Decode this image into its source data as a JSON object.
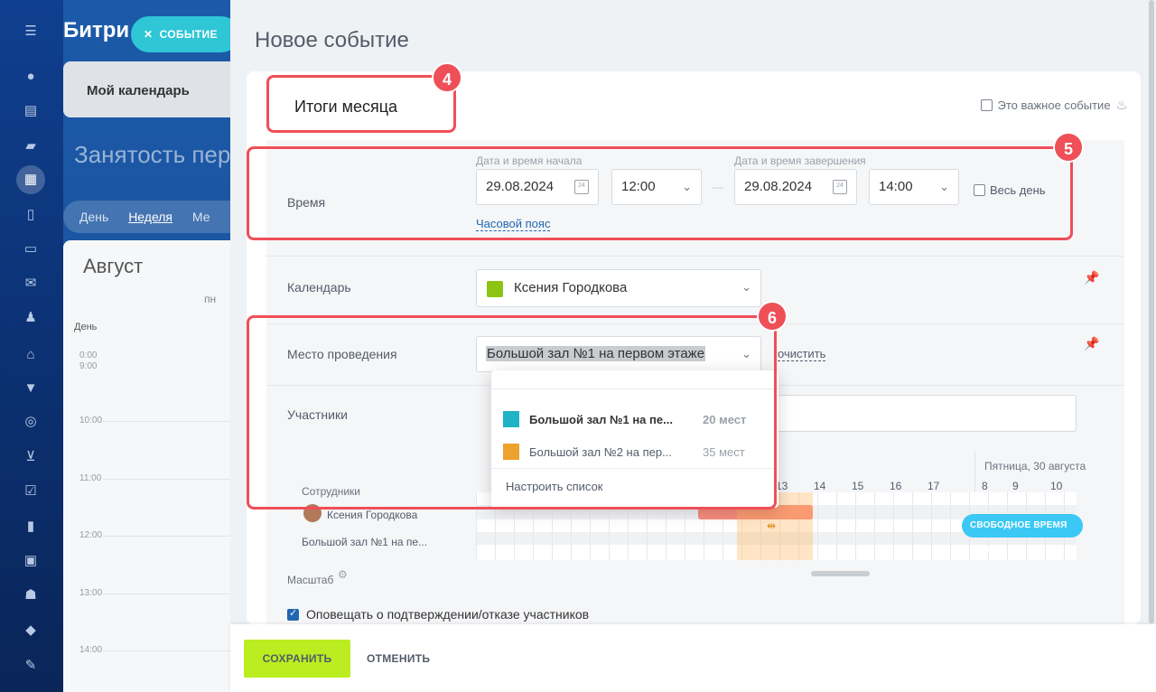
{
  "background": {
    "brand": "Битри",
    "event_button": "СОБЫТИЕ",
    "my_calendar": "Мой календарь",
    "busy_title": "Занятость пер",
    "views": [
      "День",
      "Неделя",
      "Ме"
    ],
    "month": "Август",
    "weekday": "пн",
    "day_label": "День",
    "times": [
      "0:00",
      "9:00",
      "10:00",
      "11:00",
      "12:00",
      "13:00",
      "14:00"
    ]
  },
  "panel": {
    "title": "Новое событие",
    "event_name": "Итоги месяца",
    "important_label": "Это важное событие",
    "time": {
      "label": "Время",
      "start_caption": "Дата и время начала",
      "end_caption": "Дата и время завершения",
      "start_date": "29.08.2024",
      "start_time": "12:00",
      "dash": "—",
      "end_date": "29.08.2024",
      "end_time": "14:00",
      "all_day": "Весь день",
      "timezone_link": "Часовой пояс",
      "cal_icon_text": "24"
    },
    "calendar": {
      "label": "Календарь",
      "value": "Ксения Городкова",
      "color": "#8dc313"
    },
    "location": {
      "label": "Место проведения",
      "value": "Большой зал №1 на первом этаже",
      "clear_link": "очистить",
      "options": [
        {
          "name": "Большой зал №1 на пе...",
          "capacity": "20 мест",
          "color": "#1eb4c6",
          "selected": true
        },
        {
          "name": "Большой зал №2 на пер...",
          "capacity": "35 мест",
          "color": "#eda12f",
          "selected": false
        }
      ],
      "configure": "Настроить список"
    },
    "participants": {
      "label": "Участники"
    },
    "planner": {
      "employees_label": "Сотрудники",
      "date_label": "Пятница, 30 августа",
      "hours_left": [
        "13",
        "14",
        "15",
        "16",
        "17"
      ],
      "hours_right": [
        "8",
        "9",
        "10"
      ],
      "rows": [
        "Ксения Городкова",
        "Большой зал №1 на пе..."
      ],
      "scale_label": "Масштаб",
      "free_time_button": "СВОБОДНОЕ ВРЕМЯ"
    },
    "notify_label": "Оповещать о подтверждении/отказе участников",
    "save_button": "СОХРАНИТЬ",
    "cancel_button": "ОТМЕНИТЬ"
  },
  "annotations": [
    "4",
    "5",
    "6"
  ]
}
